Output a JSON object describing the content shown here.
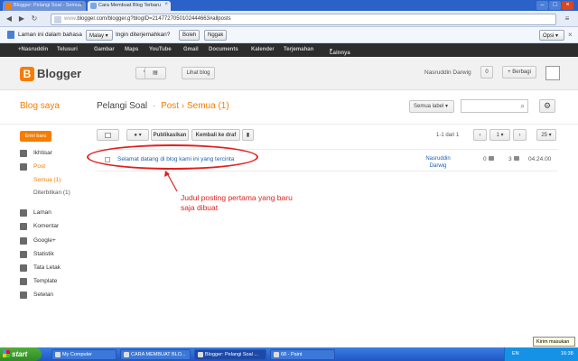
{
  "browser": {
    "tabs": [
      {
        "label": "Blogger: Pelangi Soal - Semua",
        "active": false
      },
      {
        "label": "Cara Membuat Blog Terbaru",
        "active": true
      }
    ],
    "url_scheme": "www.",
    "url_rest": "blogger.com/blogger.g?blogID=2147727050102444663#allposts",
    "translate_bar": {
      "prefix": "Laman ini dalam bahasa",
      "language": "Malay",
      "question": "Ingin diterjemahkan?",
      "yes": "Boleh",
      "no": "Nggak",
      "options": "Opsi"
    }
  },
  "gbar": {
    "items": [
      "+Nasruddin",
      "Telusuri",
      "Gambar",
      "Maps",
      "YouTube",
      "Gmail",
      "Documents",
      "Kalender",
      "Terjemahan",
      "Lainnya"
    ]
  },
  "blogger": {
    "logo": "B",
    "brand": "Blogger",
    "view_blog": "Lihat blog",
    "user": "Nasruddin Darwig",
    "notif_count": "0",
    "share": "+ Berbagi",
    "blog_saya": "Blog saya",
    "breadcrumb": {
      "blog": "Pelangi Soal",
      "sep": "·",
      "section": "Post",
      "arrow": "›",
      "filter": "Semua (1)"
    },
    "label_filter": "Semua label",
    "new_post": "Entri baru",
    "sidebar": [
      {
        "label": "Ikhtisar",
        "icon": "home-icon"
      },
      {
        "label": "Post",
        "icon": "post-icon",
        "active": true
      },
      {
        "label": "Laman",
        "icon": "page-icon"
      },
      {
        "label": "Komentar",
        "icon": "comment-icon"
      },
      {
        "label": "Google+",
        "icon": "google-plus-icon"
      },
      {
        "label": "Statistik",
        "icon": "stats-icon"
      },
      {
        "label": "Tata Letak",
        "icon": "layout-icon"
      },
      {
        "label": "Template",
        "icon": "template-icon"
      },
      {
        "label": "Setelan",
        "icon": "settings-icon"
      }
    ],
    "sub_items": [
      "Semua (1)",
      "Diterbitkan (1)"
    ],
    "toolbar": {
      "publish": "Publikasikan",
      "revert": "Kembali ke draf"
    },
    "pagination": {
      "range": "1-1 dari 1",
      "page": "1",
      "per_page": "25"
    },
    "post": {
      "title": "Selamat datang di blog kami ini yang tercinta",
      "author_line1": "Nasruddin",
      "author_line2": "Darwig",
      "comments": "0",
      "views": "3",
      "time": "04.24.00"
    },
    "annotation": "Judul posting pertama yang baru saja dibuat"
  },
  "taskbar": {
    "start": "start",
    "items": [
      "My Computer",
      "CARA MEMBUAT BLO...",
      "Blogger: Pelangi Soal ...",
      "68 - Paint"
    ],
    "lang": "EN",
    "clock": "16:38",
    "tooltip": "Kirim masukan"
  },
  "colors": {
    "accent": "#f57d00",
    "annotation": "#e41e1e",
    "link": "#1a5fb4"
  }
}
